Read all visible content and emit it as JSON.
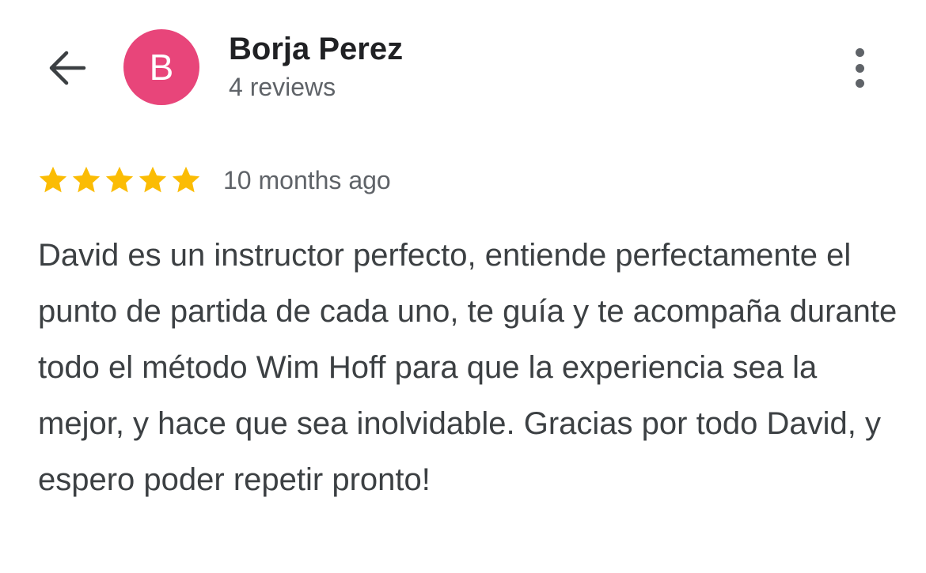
{
  "header": {
    "back_icon": "arrow-back-icon",
    "avatar_letter": "B",
    "avatar_color": "#e8457a",
    "reviewer_name": "Borja Perez",
    "review_count": "4 reviews",
    "more_icon": "more-vert-icon"
  },
  "review": {
    "rating": 5,
    "rating_max": 5,
    "star_color": "#fbbc04",
    "time_ago": "10 months ago",
    "text": "David es un instructor perfecto, entiende perfectamente el punto de partida de cada uno, te guía y te acompaña durante todo el método Wim Hoff para que la experiencia sea la mejor, y hace que sea inolvidable. Gracias por todo David, y espero poder repetir pronto!"
  }
}
